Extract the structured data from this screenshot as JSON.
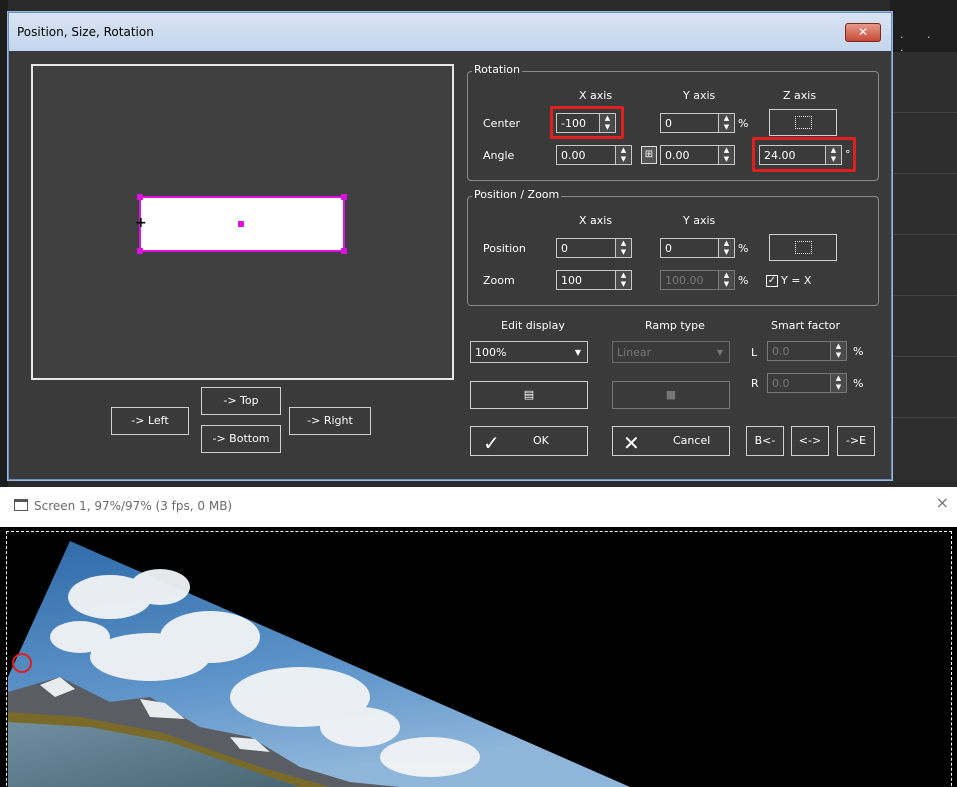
{
  "dialog": {
    "title": "Position, Size, Rotation",
    "close_icon": "close-icon"
  },
  "rotation": {
    "group_label": "Rotation",
    "col_x": "X axis",
    "col_y": "Y axis",
    "col_z": "Z axis",
    "center_label": "Center",
    "angle_label": "Angle",
    "center_x": "-100",
    "center_y": "0",
    "center_unit": "%",
    "angle_x": "0.00",
    "angle_y": "0.00",
    "angle_z": "24.00",
    "angle_unit": "°"
  },
  "position_zoom": {
    "group_label": "Position / Zoom",
    "col_x": "X axis",
    "col_y": "Y axis",
    "position_label": "Position",
    "zoom_label": "Zoom",
    "position_x": "0",
    "position_y": "0",
    "position_unit": "%",
    "zoom_x": "100",
    "zoom_y": "100.00",
    "zoom_unit": "%",
    "yx_checkbox_label": "Y = X",
    "yx_checked": true
  },
  "edit_display": {
    "label": "Edit display",
    "value": "100%"
  },
  "ramp_type": {
    "label": "Ramp type",
    "value": "Linear"
  },
  "smart_factor": {
    "label": "Smart factor",
    "l_label": "L",
    "l_value": "0.0",
    "r_label": "R",
    "r_value": "0.0",
    "unit": "%"
  },
  "nav_buttons": {
    "left": "-> Left",
    "top": "-> Top",
    "bottom": "-> Bottom",
    "right": "-> Right"
  },
  "actions": {
    "ok": "OK",
    "cancel": "Cancel",
    "b_start": "B<-",
    "b_both": "<->",
    "b_end": "->E"
  },
  "screen": {
    "title": "Screen 1, 97%/97% (3 fps, 0 MB)"
  },
  "colors": {
    "accent_highlight": "#e02020",
    "handle_magenta": "#e010e0",
    "dialog_bg": "#3a3a3a"
  }
}
